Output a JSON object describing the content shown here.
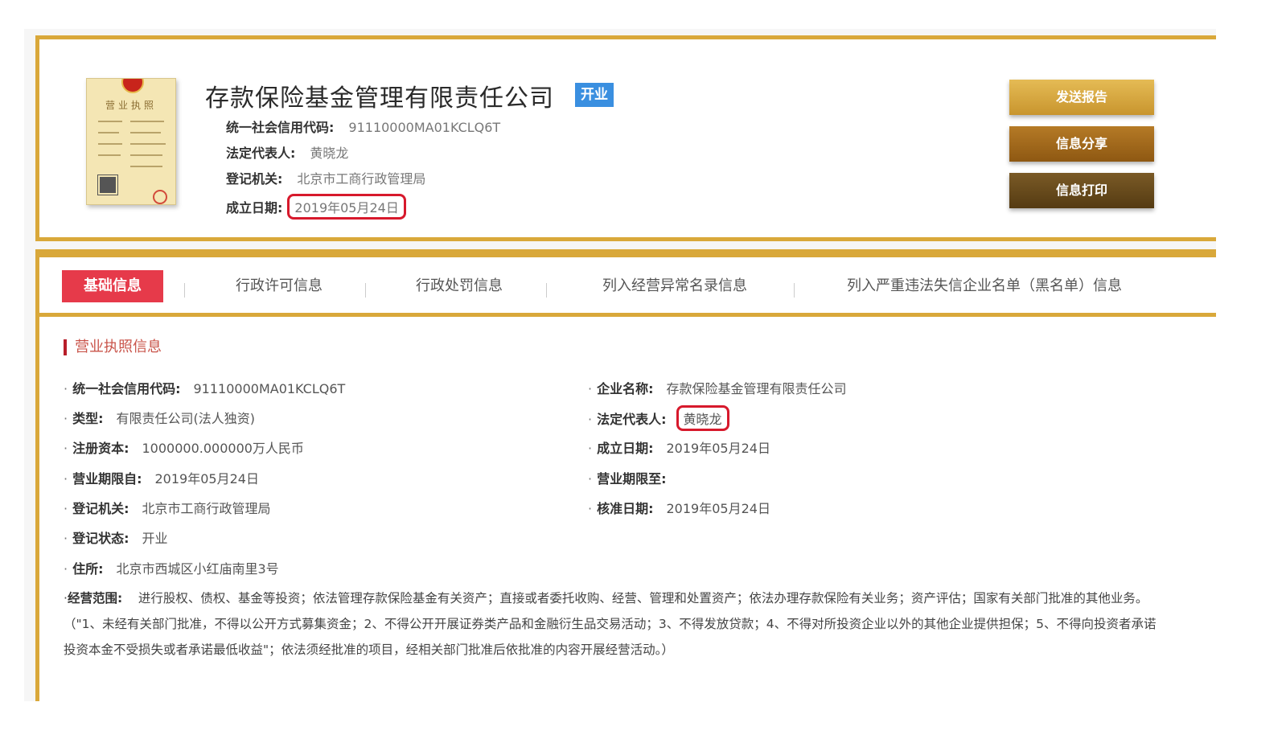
{
  "company": {
    "name": "存款保险基金管理有限责任公司",
    "status": "开业",
    "summary": [
      {
        "label": "统一社会信用代码:",
        "value": "91110000MA01KCLQ6T"
      },
      {
        "label": "法定代表人:",
        "value": "黄晓龙"
      },
      {
        "label": "登记机关:",
        "value": "北京市工商行政管理局"
      },
      {
        "label": "成立日期:",
        "value": "2019年05月24日"
      }
    ]
  },
  "license_image": {
    "title": "营业执照"
  },
  "actions": {
    "send_report": "发送报告",
    "share_info": "信息分享",
    "print_info": "信息打印"
  },
  "tabs": [
    {
      "label": "基础信息",
      "active": true
    },
    {
      "label": "行政许可信息",
      "active": false
    },
    {
      "label": "行政处罚信息",
      "active": false
    },
    {
      "label": "列入经营异常名录信息",
      "active": false
    },
    {
      "label": "列入严重违法失信企业名单（黑名单）信息",
      "active": false
    }
  ],
  "section": {
    "title": "营业执照信息"
  },
  "left_fields": [
    {
      "label": "统一社会信用代码:",
      "value": "91110000MA01KCLQ6T"
    },
    {
      "label": "类型:",
      "value": "有限责任公司(法人独资)"
    },
    {
      "label": "注册资本:",
      "value": "1000000.000000万人民币"
    },
    {
      "label": "营业期限自:",
      "value": "2019年05月24日"
    },
    {
      "label": "登记机关:",
      "value": "北京市工商行政管理局"
    },
    {
      "label": "登记状态:",
      "value": "开业"
    },
    {
      "label": "住所:",
      "value": "北京市西城区小红庙南里3号"
    }
  ],
  "right_fields": [
    {
      "label": "企业名称:",
      "value": "存款保险基金管理有限责任公司"
    },
    {
      "label": "法定代表人:",
      "value": "黄晓龙"
    },
    {
      "label": "成立日期:",
      "value": "2019年05月24日"
    },
    {
      "label": "营业期限至:",
      "value": ""
    },
    {
      "label": "核准日期:",
      "value": "2019年05月24日"
    }
  ],
  "business_scope": {
    "label": "经营范围:",
    "value": "进行股权、债权、基金等投资；依法管理存款保险基金有关资产；直接或者委托收购、经营、管理和处置资产；依法办理存款保险有关业务；资产评估；国家有关部门批准的其他业务。（\"1、未经有关部门批准，不得以公开方式募集资金；2、不得公开开展证券类产品和金融衍生品交易活动；3、不得发放贷款；4、不得对所投资企业以外的其他企业提供担保；5、不得向投资者承诺投资本金不受损失或者承诺最低收益\"；依法须经批准的项目，经相关部门批准后依批准的内容开展经营活动。）"
  },
  "colors": {
    "gold_border": "#d9a83a",
    "active_tab": "#e63a4a",
    "status_badge": "#3a8fe0",
    "highlight_circle": "#d7192c"
  }
}
